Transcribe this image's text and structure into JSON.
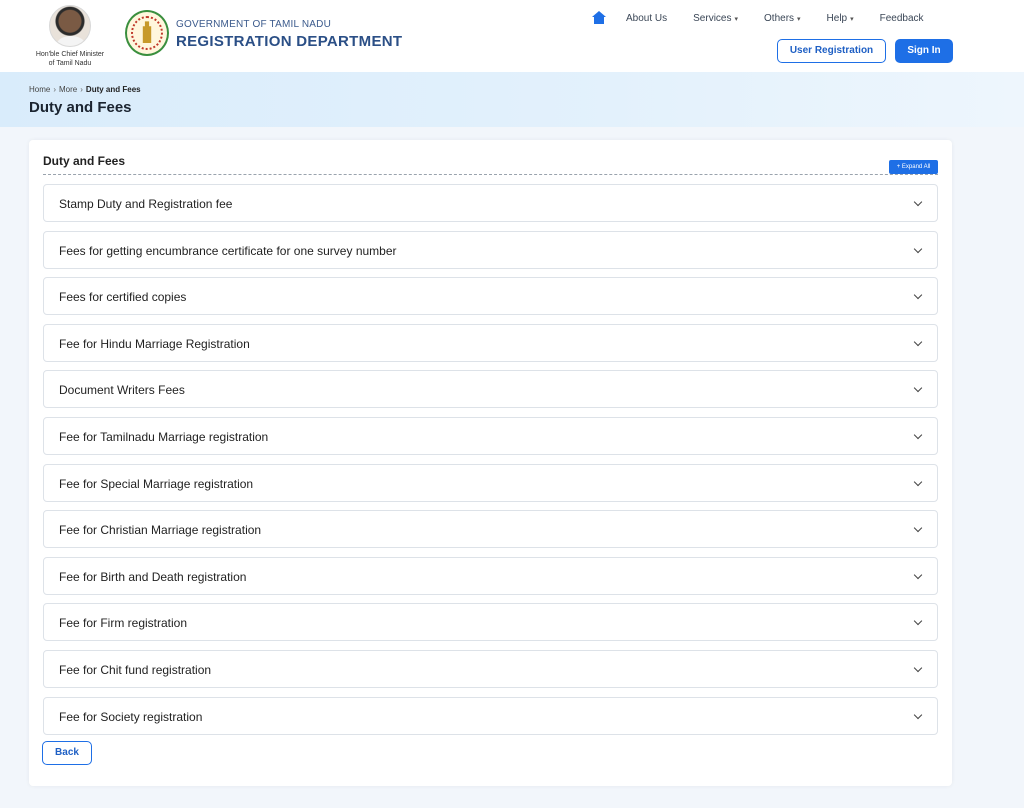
{
  "header": {
    "cm_caption_line1": "Hon'ble Chief Minister",
    "cm_caption_line2": "of Tamil Nadu",
    "gov_line": "GOVERNMENT OF TAMIL NADU",
    "dept_line": "REGISTRATION DEPARTMENT"
  },
  "nav": {
    "items": [
      "About Us",
      "Services",
      "Others",
      "Help",
      "Feedback"
    ]
  },
  "actions": {
    "user_registration": "User Registration",
    "sign_in": "Sign In"
  },
  "breadcrumb": {
    "home": "Home",
    "parent": "More",
    "current": "Duty and Fees"
  },
  "page_title": "Duty and Fees",
  "card": {
    "title": "Duty and Fees",
    "expand_all": "+ Expand All",
    "accordion": [
      "Stamp Duty and Registration fee",
      "Fees for getting encumbrance certificate for one survey number",
      "Fees for certified copies",
      "Fee for Hindu Marriage Registration",
      "Document Writers Fees",
      "Fee for Tamilnadu Marriage registration",
      "Fee for Special Marriage registration",
      "Fee for Christian Marriage registration",
      "Fee for Birth and Death registration",
      "Fee for Firm registration",
      "Fee for Chit fund registration",
      "Fee for Society registration"
    ],
    "back": "Back"
  },
  "colors": {
    "primary": "#1e6fe6",
    "dept_text": "#2b4f86",
    "banner": "#d9ecfb"
  }
}
